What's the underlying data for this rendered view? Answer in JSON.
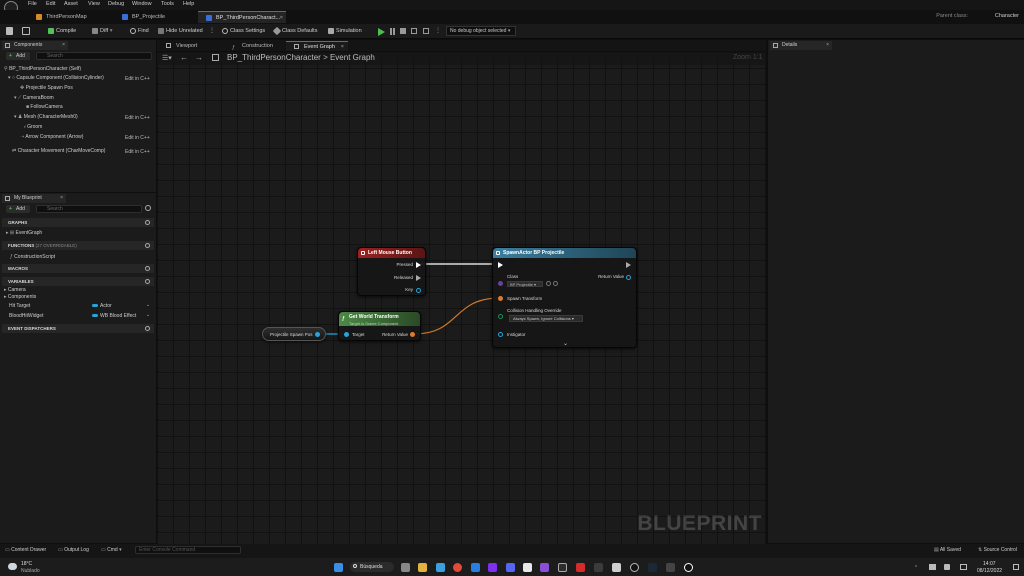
{
  "menubar": {
    "items": [
      "File",
      "Edit",
      "Asset",
      "View",
      "Debug",
      "Window",
      "Tools",
      "Help"
    ]
  },
  "tabs": [
    {
      "label": "ThirdPersonMap"
    },
    {
      "label": "BP_Projectile"
    },
    {
      "label": "BP_ThirdPersonCharact..."
    }
  ],
  "parent_class": {
    "label": "Parent class:",
    "value": "Character"
  },
  "toolbar": {
    "compile": "Compile",
    "diff": "Diff",
    "find": "Find",
    "hide_unrelated": "Hide Unrelated",
    "class_settings": "Class Settings",
    "class_defaults": "Class Defaults",
    "simulation": "Simulation",
    "debug_select": "No debug object selected"
  },
  "components": {
    "tab": "Components",
    "add": "Add",
    "search_placeholder": "Search",
    "items": [
      {
        "label": "BP_ThirdPersonCharacter (Self)",
        "edit": ""
      },
      {
        "label": "Capsule Component (CollisionCylinder)",
        "edit": "Edit in C++"
      },
      {
        "label": "Projectile Spawn Pos",
        "edit": ""
      },
      {
        "label": "CameraBoom",
        "edit": ""
      },
      {
        "label": "FollowCamera",
        "edit": ""
      },
      {
        "label": "Mesh (CharacterMesh0)",
        "edit": "Edit in C++"
      },
      {
        "label": "Groom",
        "edit": ""
      },
      {
        "label": "Arrow Component (Arrow)",
        "edit": "Edit in C++"
      },
      {
        "label": "Character Movement (CharMoveComp)",
        "edit": "Edit in C++"
      }
    ]
  },
  "my_blueprint": {
    "tab": "My Blueprint",
    "add": "Add",
    "search_placeholder": "Search",
    "graphs_header": "GRAPHS",
    "event_graph": "EventGraph",
    "functions_header": "FUNCTIONS",
    "functions_overridable": "(27 OVERRIDABLE)",
    "construction_script": "ConstructionScript",
    "macros_header": "MACROS",
    "variables_header": "VARIABLES",
    "var_categories": [
      "Camera",
      "Components"
    ],
    "variables": [
      {
        "name": "Hit Target",
        "type": "Actor"
      },
      {
        "name": "BloodHitWidget",
        "type": "WB Blood Effect"
      }
    ],
    "dispatchers_header": "EVENT DISPATCHERS"
  },
  "editor_tabs": [
    {
      "label": "Viewport"
    },
    {
      "label": "Construction Sc..."
    },
    {
      "label": "Event Graph"
    }
  ],
  "breadcrumb": {
    "root": "BP_ThirdPersonCharacter",
    "separator": ">",
    "leaf": "Event Graph"
  },
  "zoom": "Zoom 1:1",
  "nodes": {
    "lmb": {
      "title": "Left Mouse Button",
      "pressed": "Pressed",
      "released": "Released",
      "key": "Key"
    },
    "spawn": {
      "title": "SpawnActor BP Projectile",
      "class_label": "Class",
      "class_value": "BP Projectile",
      "return_value": "Return Value",
      "spawn_transform": "Spawn Transform",
      "collision_label": "Collision Handling Override",
      "collision_value": "Always Spawn, Ignore Collisions",
      "instigator": "Instigator"
    },
    "transform": {
      "title": "Get World Transform",
      "subtitle": "Target is Scene Component",
      "target": "Target",
      "return_value": "Return Value"
    },
    "spawn_pos": {
      "label": "Projectile Spawn Pos"
    }
  },
  "watermark": "BLUEPRINT",
  "details": {
    "tab": "Details"
  },
  "statusbar": {
    "content_drawer": "Content Drawer",
    "output_log": "Output Log",
    "cmd": "Cmd",
    "console_placeholder": "Enter Console Command",
    "all_saved": "All Saved",
    "source_control": "Source Control"
  },
  "taskbar": {
    "temperature": "18°C",
    "weather": "Nublado",
    "search": "Búsqueda",
    "time": "14:07",
    "date": "08/12/2022"
  },
  "colors": {
    "accent": "#3a6fd8",
    "lmb_header": "#8a1d1d",
    "spawn_header": "#2d6f8c",
    "transform_header": "#3f7d3a",
    "exec_wire": "#ffffff",
    "transform_wire": "#d07a2a"
  }
}
